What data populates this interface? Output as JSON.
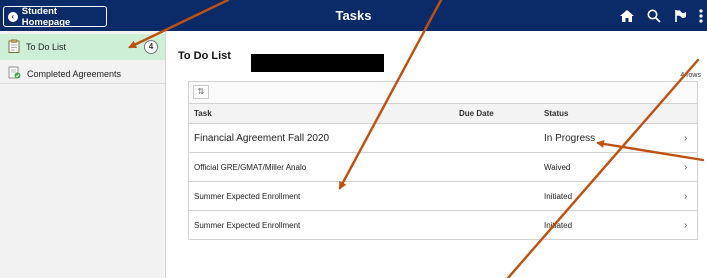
{
  "banner": {
    "home_button_label": "Student Homepage",
    "title": "Tasks",
    "icons": [
      "home-icon",
      "search-icon",
      "flag-icon",
      "more-menu-icon"
    ]
  },
  "leftnav": {
    "items": [
      {
        "label": "To Do List",
        "count": "4",
        "icon": "clipboard-icon",
        "active": true
      },
      {
        "label": "Completed Agreements",
        "icon": "completed-agreements-icon",
        "active": false
      }
    ]
  },
  "main": {
    "title": "To Do List",
    "rows_count": "4 rows",
    "columns": {
      "task": "Task",
      "due_date": "Due Date",
      "status": "Status"
    },
    "rows": [
      {
        "task": "Financial Agreement Fall 2020",
        "due_date": "",
        "status": "In Progress"
      },
      {
        "task": "Official GRE/GMAT/Miller Analo",
        "due_date": "",
        "status": "Waived"
      },
      {
        "task": "Summer Expected Enrollment",
        "due_date": "",
        "status": "Initiated"
      },
      {
        "task": "Summer Expected Enrollment",
        "due_date": "",
        "status": "Initiated"
      }
    ]
  },
  "colors": {
    "banner": "#0a2a68",
    "active_nav": "#ccefd6",
    "annotation_arrow": "#c05010"
  }
}
